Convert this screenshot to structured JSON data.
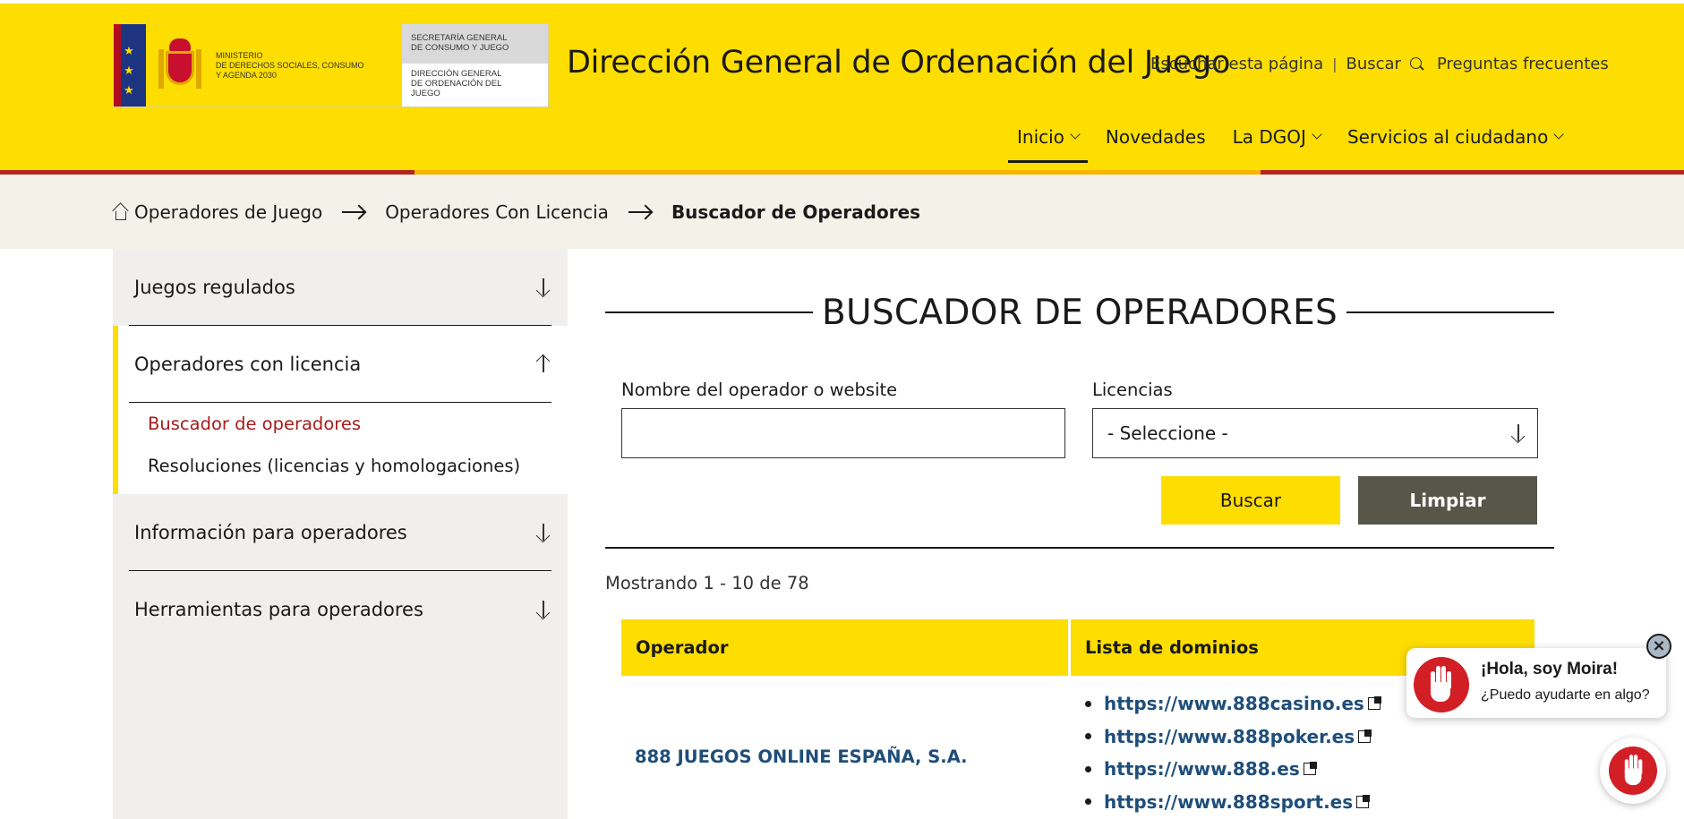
{
  "header": {
    "logo": {
      "ministry_line1": "Ministerio",
      "ministry_line2": "de Derechos Sociales, Consumo",
      "ministry_line3": "y Agenda 2030",
      "secretaria_line1": "Secretaría General",
      "secretaria_line2": "de Consumo y Juego",
      "direccion_line1": "Dirección General",
      "direccion_line2": "de Ordenación del",
      "direccion_line3": "Juego"
    },
    "site_title": "Dirección General de Ordenación del Juego",
    "utility": {
      "listen": "Escuchar esta página",
      "separator": "|",
      "search": "Buscar",
      "faq": "Preguntas frecuentes"
    },
    "nav": [
      {
        "label": "Inicio"
      },
      {
        "label": "Novedades"
      },
      {
        "label": "La DGOJ"
      },
      {
        "label": "Servicios al ciudadano"
      }
    ]
  },
  "breadcrumb": {
    "items": [
      "Operadores de Juego",
      "Operadores Con Licencia",
      "Buscador de Operadores"
    ]
  },
  "sidebar": {
    "sections": [
      {
        "label": "Juegos regulados"
      },
      {
        "label": "Operadores con licencia",
        "sub": [
          "Buscador de operadores",
          "Resoluciones (licencias y homologaciones)"
        ]
      },
      {
        "label": "Información para operadores"
      },
      {
        "label": "Herramientas para operadores"
      }
    ]
  },
  "main": {
    "heading": "BUSCADOR DE OPERADORES",
    "form": {
      "operator_label": "Nombre del operador o website",
      "operator_value": "",
      "license_label": "Licencias",
      "license_selected": "- Seleccione -",
      "search_button": "Buscar",
      "clear_button": "Limpiar"
    },
    "results_count": "Mostrando 1 - 10 de 78",
    "table": {
      "headers": [
        "Operador",
        "Lista de dominios"
      ],
      "rows": [
        {
          "operator": "888 JUEGOS ONLINE ESPAÑA, S.A.",
          "domains": [
            "https://www.888casino.es",
            "https://www.888poker.es",
            "https://www.888.es",
            "https://www.888sport.es"
          ]
        }
      ]
    }
  },
  "chat": {
    "title": "¡Hola, soy Moira!",
    "subtitle": "¿Puedo ayudarte en algo?",
    "close_symbol": "×"
  },
  "colors": {
    "header_yellow": "#fedd00",
    "stripe_red": "#b3261e",
    "stripe_gold": "#f7b500",
    "breadcrumb_bg": "#f4f1e8",
    "sidebar_bg": "#f0efed",
    "active_red": "#a61c1c",
    "link_blue": "#1f4e79",
    "clear_button": "#585649",
    "chat_red": "#d21f26"
  }
}
